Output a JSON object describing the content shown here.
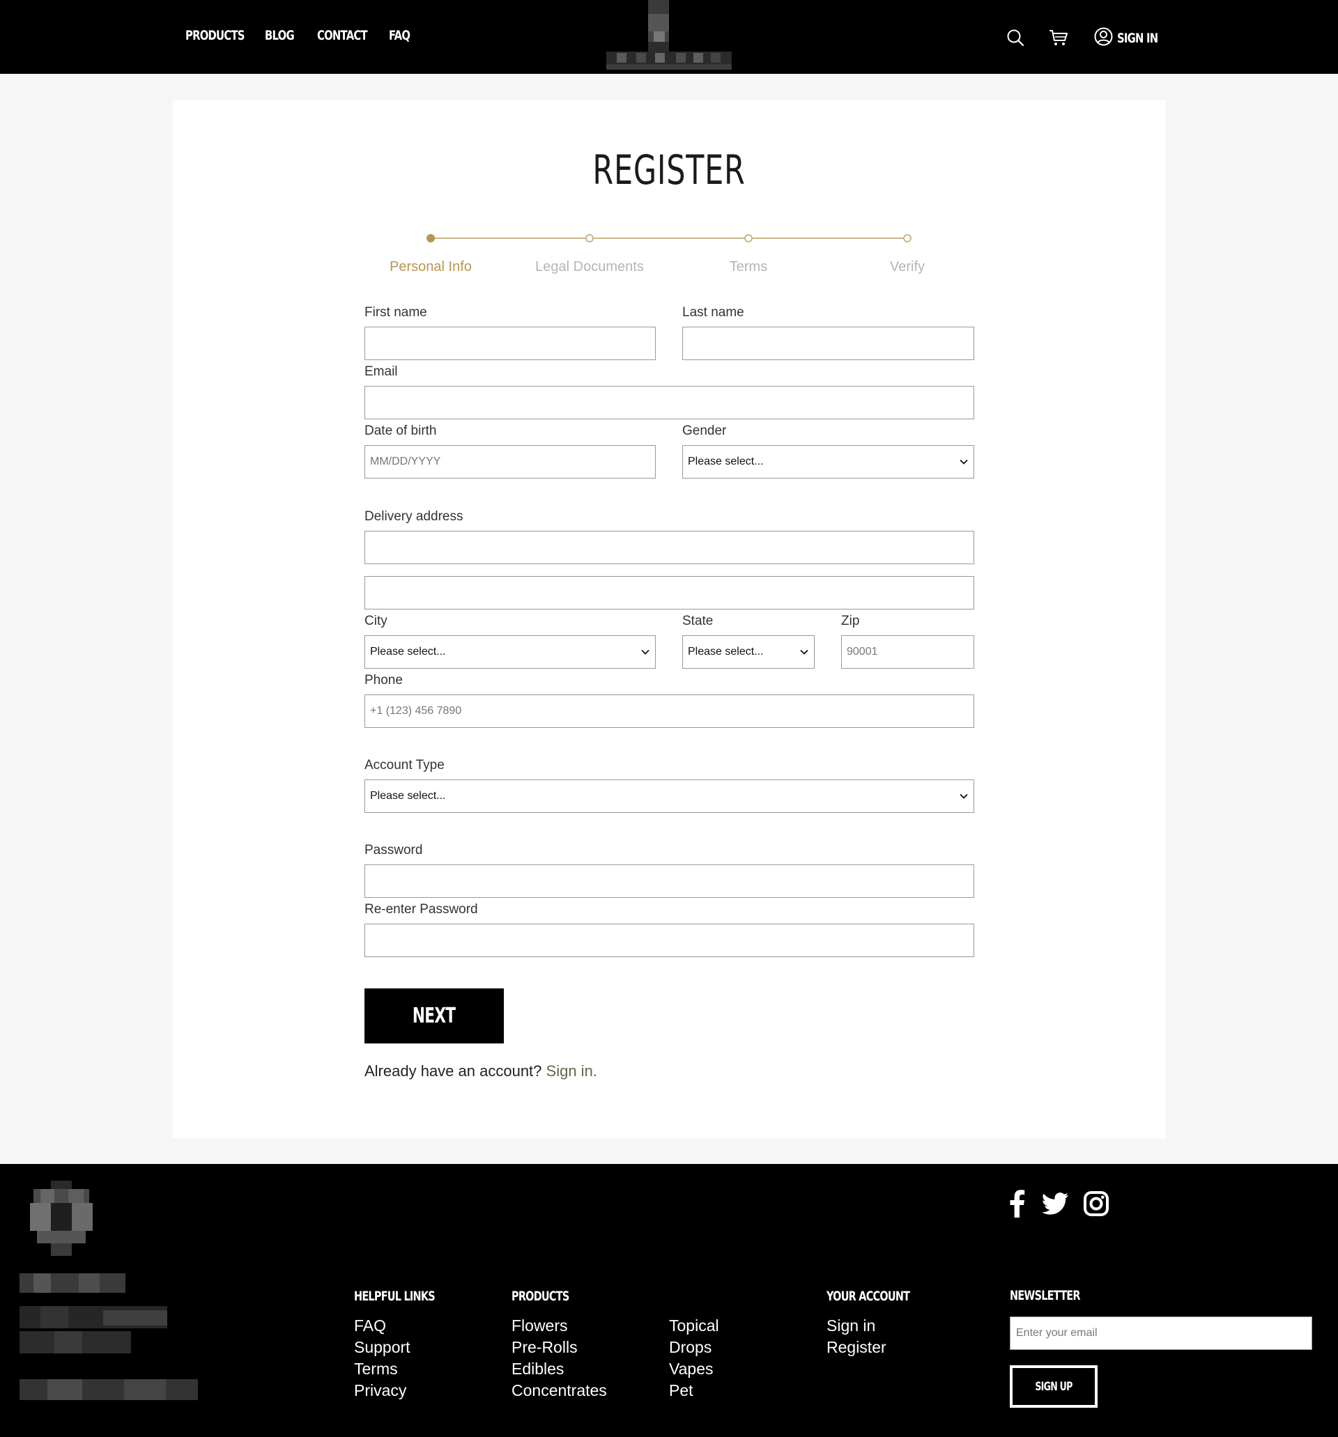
{
  "header": {
    "nav": [
      "PRODUCTS",
      "BLOG",
      "CONTACT",
      "FAQ"
    ],
    "sign_in": "SIGN IN",
    "icons": [
      "search-icon",
      "cart-icon",
      "user-icon"
    ]
  },
  "page": {
    "title": "REGISTER",
    "steps": [
      "Personal Info",
      "Legal Documents",
      "Terms",
      "Verify"
    ],
    "active_step": "Personal Info"
  },
  "form": {
    "first_name_label": "First name",
    "last_name_label": "Last name",
    "email_label": "Email",
    "dob_label": "Date of birth",
    "dob_placeholder": "MM/DD/YYYY",
    "gender_label": "Gender",
    "gender_value": "Please select...",
    "delivery_label": "Delivery address",
    "city_label": "City",
    "city_value": "Please select...",
    "state_label": "State",
    "state_value": "Please select...",
    "zip_label": "Zip",
    "zip_placeholder": "90001",
    "phone_label": "Phone",
    "phone_placeholder": "+1 (123) 456 7890",
    "account_type_label": "Account Type",
    "account_type_value": "Please select...",
    "password_label": "Password",
    "reenter_label": "Re-enter Password",
    "next_label": "NEXT",
    "already_text": "Already have an account?",
    "sign_in_link": "Sign in."
  },
  "footer": {
    "helpful_heading": "HELPFUL LINKS",
    "helpful_links": [
      "FAQ",
      "Support",
      "Terms",
      "Privacy"
    ],
    "products_heading": "PRODUCTS",
    "products_col1": [
      "Flowers",
      "Pre-Rolls",
      "Edibles",
      "Concentrates"
    ],
    "products_col2": [
      "Topical",
      "Drops",
      "Vapes",
      "Pet"
    ],
    "account_heading": "YOUR ACCOUNT",
    "account_links": [
      "Sign in",
      "Register"
    ],
    "newsletter_heading": "NEWSLETTER",
    "newsletter_placeholder": "Enter your email",
    "newsletter_button": "SIGN UP",
    "social": [
      "facebook-icon",
      "twitter-icon",
      "instagram-icon"
    ]
  },
  "colors": {
    "accent": "#b8964f",
    "header_bg": "#000000",
    "page_bg": "#f6f6f6"
  }
}
